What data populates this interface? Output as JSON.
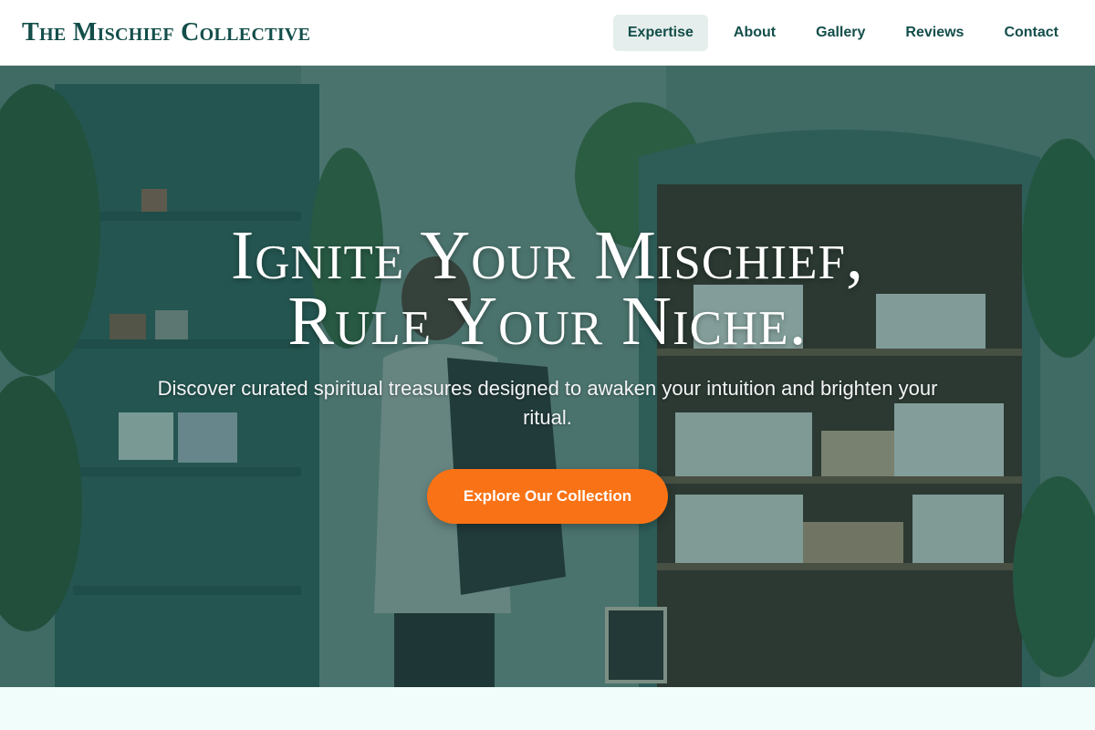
{
  "header": {
    "logo": "The Mischief Collective",
    "nav": [
      {
        "label": "Expertise",
        "active": true
      },
      {
        "label": "About",
        "active": false
      },
      {
        "label": "Gallery",
        "active": false
      },
      {
        "label": "Reviews",
        "active": false
      },
      {
        "label": "Contact",
        "active": false
      }
    ]
  },
  "hero": {
    "title_line1": "Ignite Your Mischief,",
    "title_line2": "Rule Your Niche.",
    "subtitle": "Discover curated spiritual treasures designed to awaken your intuition and brighten your ritual.",
    "cta_label": "Explore Our Collection",
    "image": "shop-interior-photo"
  },
  "colors": {
    "brand": "#134e4a",
    "accent": "#f97316",
    "nav_active_bg": "#e5eeec",
    "page_bg": "#f0fdfa"
  }
}
